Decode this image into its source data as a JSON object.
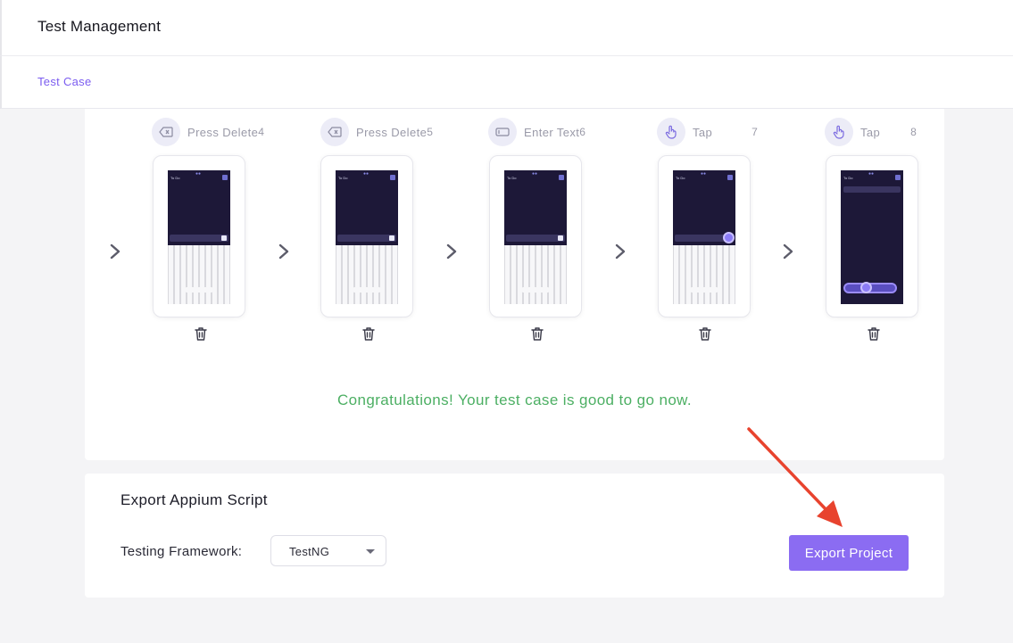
{
  "app": {
    "title": "Test Management"
  },
  "breadcrumb": {
    "label": "Test Case"
  },
  "steps": [
    {
      "label": "Press Delete",
      "number": "4",
      "icon": "backspace-icon",
      "screen": "keyboard"
    },
    {
      "label": "Press Delete",
      "number": "5",
      "icon": "backspace-icon",
      "screen": "keyboard"
    },
    {
      "label": "Enter Text",
      "number": "6",
      "icon": "text-field-icon",
      "screen": "keyboard"
    },
    {
      "label": "Tap",
      "number": "7",
      "icon": "tap-hand-icon",
      "screen": "keyboard-tap"
    },
    {
      "label": "Tap",
      "number": "8",
      "icon": "tap-hand-icon",
      "screen": "list-tap"
    }
  ],
  "phone_screen": {
    "title": "To Do",
    "dots": "●●"
  },
  "status": {
    "message": "Congratulations! Your test case is good to go now."
  },
  "export": {
    "title": "Export Appium Script",
    "framework_label": "Testing Framework:",
    "framework_value": "TestNG",
    "button_label": "Export Project"
  },
  "colors": {
    "accent": "#8b6cf2",
    "link": "#7b5cf0",
    "success": "#4caf63",
    "annotation_arrow": "#e8432e",
    "phone_screen_bg": "#1d1838"
  }
}
